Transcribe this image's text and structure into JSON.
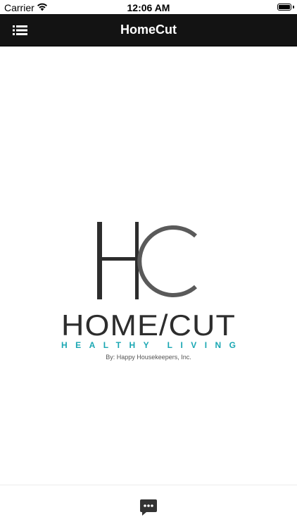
{
  "status_bar": {
    "carrier": "Carrier",
    "time": "12:06 AM"
  },
  "nav": {
    "title": "HomeCut",
    "menu_icon": "list-icon",
    "background_color": "#131313"
  },
  "logo": {
    "monogram": "HC",
    "wordmark": "HOME/CUT",
    "tagline": "HEALTHY LIVING",
    "byline": "By: Happy Housekeepers, Inc.",
    "tagline_color": "#1aa7b3"
  },
  "bottom_bar": {
    "chat_icon": "chat-bubble-icon"
  }
}
